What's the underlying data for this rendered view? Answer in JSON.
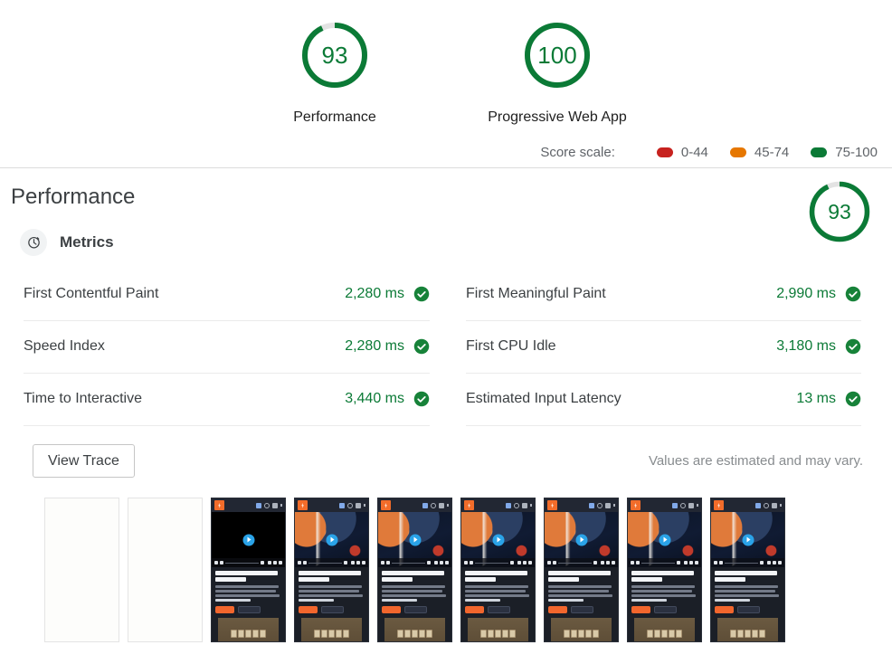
{
  "header": {
    "gauges": [
      {
        "score": "93",
        "label": "Performance",
        "color": "#0b7a36",
        "pct": 93
      },
      {
        "score": "100",
        "label": "Progressive Web App",
        "color": "#0b7a36",
        "pct": 100
      }
    ],
    "score_scale": {
      "title": "Score scale:",
      "items": [
        {
          "range": "0-44",
          "color": "#c7221f"
        },
        {
          "range": "45-74",
          "color": "#e67700"
        },
        {
          "range": "75-100",
          "color": "#0b7a36"
        }
      ]
    }
  },
  "category": {
    "title": "Performance",
    "gauge": {
      "score": "93",
      "color": "#0b7a36",
      "pct": 93
    },
    "metrics_heading": "Metrics",
    "metrics_icon": "stopwatch-icon",
    "columns": [
      {
        "rows": [
          {
            "name": "First Contentful Paint",
            "value": "2,280 ms",
            "status": "pass"
          },
          {
            "name": "Speed Index",
            "value": "2,280 ms",
            "status": "pass"
          },
          {
            "name": "Time to Interactive",
            "value": "3,440 ms",
            "status": "pass"
          }
        ]
      },
      {
        "rows": [
          {
            "name": "First Meaningful Paint",
            "value": "2,990 ms",
            "status": "pass"
          },
          {
            "name": "First CPU Idle",
            "value": "3,180 ms",
            "status": "pass"
          },
          {
            "name": "Estimated Input Latency",
            "value": "13 ms",
            "status": "pass"
          }
        ]
      }
    ],
    "view_trace_label": "View Trace",
    "estimate_note": "Values are estimated and may vary."
  },
  "filmstrip": {
    "frames": [
      {
        "state": "blank"
      },
      {
        "state": "blank"
      },
      {
        "state": "loaded",
        "video": "black"
      },
      {
        "state": "loaded",
        "video": "poster"
      },
      {
        "state": "loaded",
        "video": "poster"
      },
      {
        "state": "loaded",
        "video": "poster"
      },
      {
        "state": "loaded",
        "video": "poster"
      },
      {
        "state": "loaded",
        "video": "poster"
      },
      {
        "state": "loaded",
        "video": "poster"
      },
      {
        "state": "loaded",
        "video": "poster"
      }
    ],
    "page_mock": {
      "headline": "Build and ship 🔥 your app ⚡ faster",
      "image_caption": "LEARN"
    }
  }
}
